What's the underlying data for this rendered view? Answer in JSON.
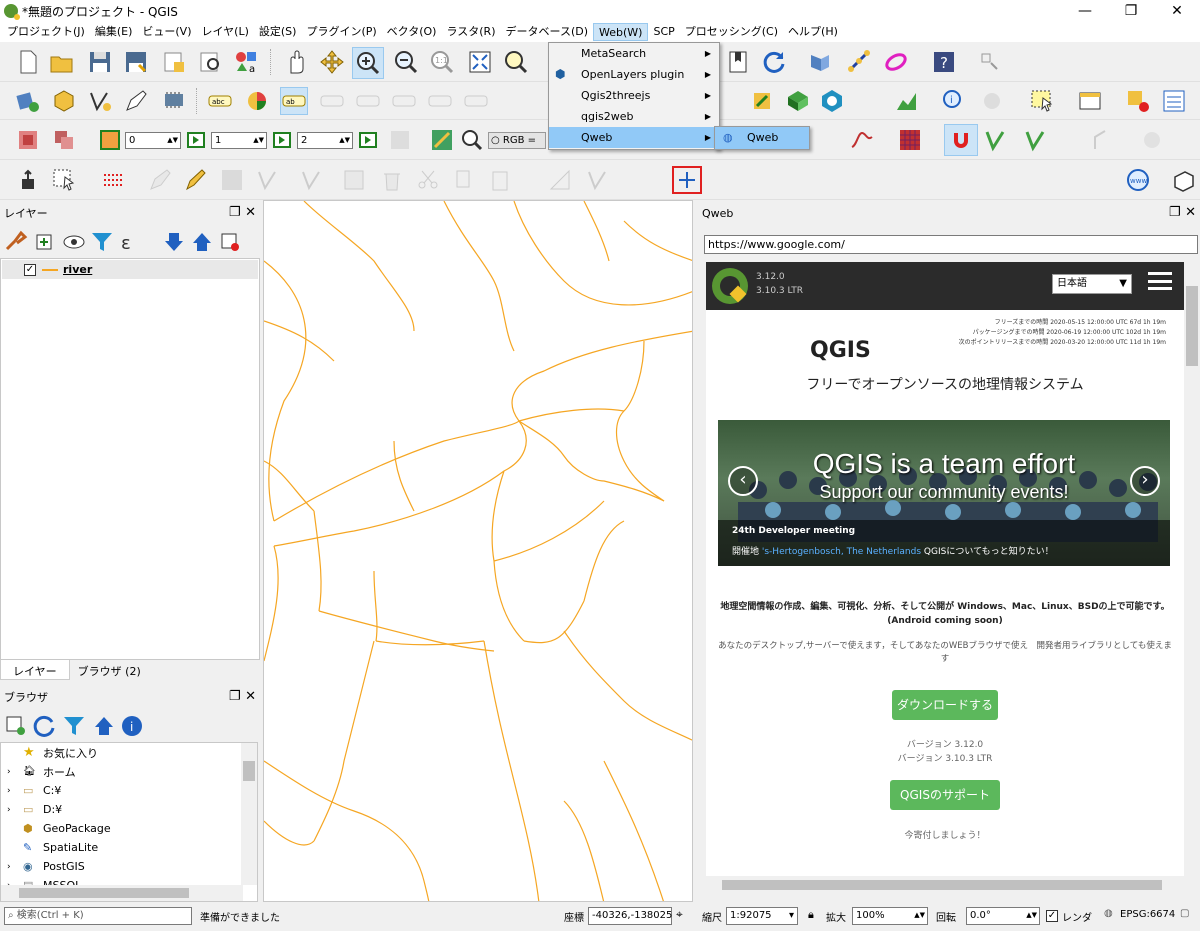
{
  "window": {
    "title": "*無題のプロジェクト - QGIS",
    "minimize": "—",
    "maximize": "❐",
    "close": "✕"
  },
  "menubar": [
    "プロジェクト(J)",
    "編集(E)",
    "ビュー(V)",
    "レイヤ(L)",
    "設定(S)",
    "プラグイン(P)",
    "ベクタ(O)",
    "ラスタ(R)",
    "データベース(D)",
    "Web(W)",
    "SCP",
    "プロセッシング(C)",
    "ヘルプ(H)"
  ],
  "web_menu": {
    "items": [
      "MetaSearch",
      "OpenLayers plugin",
      "Qgis2threejs",
      "qgis2web",
      "Qweb"
    ],
    "submenu": "Qweb"
  },
  "toolbar3": {
    "spin1": "0",
    "spin2": "1",
    "spin3": "2",
    "rgb": "RGB ="
  },
  "layers_panel": {
    "title": "レイヤー",
    "layer": "river",
    "tabs": [
      "レイヤー",
      "ブラウザ (2)"
    ]
  },
  "browser_panel": {
    "title": "ブラウザ",
    "items": [
      "お気に入り",
      "ホーム",
      "C:¥",
      "D:¥",
      "GeoPackage",
      "SpatiaLite",
      "PostGIS",
      "MSSQL"
    ]
  },
  "qweb_panel": {
    "title": "Qweb",
    "url": "https://www.google.com/"
  },
  "webpage": {
    "version": "3.12.0",
    "ltr": "3.10.3 LTR",
    "lang": "日本語",
    "freeze": [
      "フリーズまでの時間 2020-05-15 12:00:00 UTC 67d 1h 19m",
      "パッケージングまでの時間 2020-06-19 12:00:00 UTC 102d 1h 19m",
      "次のポイントリリースまでの時間 2020-03-20 12:00:00 UTC 11d 1h 19m"
    ],
    "brand": "QGIS",
    "tagline": "フリーでオープンソースの地理情報システム",
    "hero_title": "QGIS is a team effort",
    "hero_sub": "Support our community events!",
    "meeting": "24th Developer meeting",
    "venue_prefix": "開催地",
    "venue_link": "'s-Hertogenbosch, The Netherlands",
    "venue_more": "QGISについてもっと知りたい！",
    "desc1": "地理空間情報の作成、編集、可視化、分析、そして公開が Windows、Mac、Linux、BSDの上で可能です。(Android coming soon)",
    "desc2": "あなたのデスクトップ,サーバーで使えます，そしてあなたのWEBブラウザで使え　開発者用ライブラリとしても使えます",
    "download_btn": "ダウンロードする",
    "ver_line1": "バージョン 3.12.0",
    "ver_line2": "バージョン 3.10.3 LTR",
    "support_btn": "QGISのサポート",
    "donate": "今寄付しましょう！"
  },
  "status": {
    "search": "検索(Ctrl + K)",
    "ready": "準備ができました",
    "coord_label": "座標",
    "coord": "-40326,-138025",
    "scale_label": "縮尺",
    "scale": "1:92075",
    "magnify_label": "拡大",
    "magnify": "100%",
    "rotate_label": "回転",
    "rotate": "0.0°",
    "render": "レンダ",
    "crs": "EPSG:6674"
  },
  "colors": {
    "river": "#f5a623",
    "qgis_green": "#589632",
    "menu_highlight": "#91c9f7"
  }
}
